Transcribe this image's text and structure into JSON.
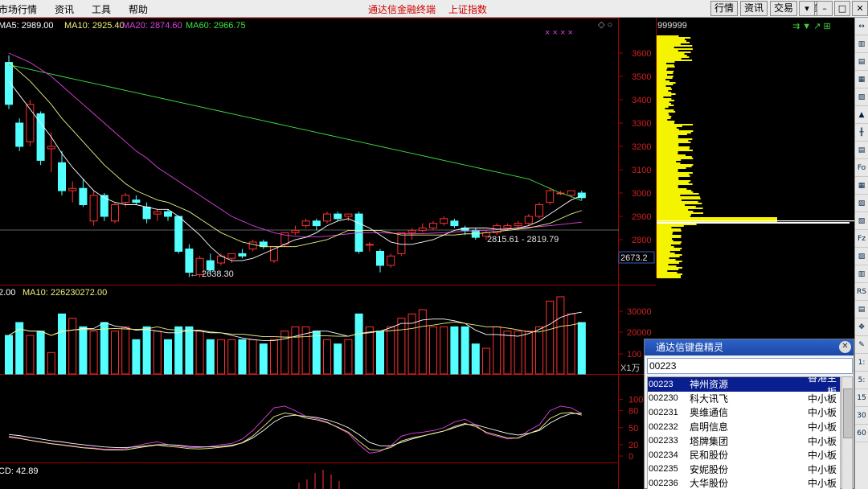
{
  "menu": [
    "市场行情",
    "资讯",
    "工具",
    "帮助"
  ],
  "app_title": [
    "通达信金融终端",
    "上证指数"
  ],
  "nav_buttons": [
    "行情",
    "资讯",
    "交易",
    "服务"
  ],
  "window_controls": [
    "▾",
    "–",
    "□",
    "✕"
  ],
  "ma_legend": [
    {
      "text": "MA5: 2989.00",
      "color": "#ffffff"
    },
    {
      "text": "MA10: 2925.40",
      "color": "#f0f080"
    },
    {
      "text": "MA20: 2874.60",
      "color": "#e040e0"
    },
    {
      "text": "MA60: 2966.75",
      "color": "#40e040"
    }
  ],
  "price_axis": [
    "3600",
    "3500",
    "3400",
    "3300",
    "3200",
    "3100",
    "3000",
    "2900",
    "2800"
  ],
  "current_price": "2673.2",
  "low_annotation": "2638.30",
  "range_annotation": "2815.61 - 2819.79",
  "volume_legend": [
    {
      "text": "2.00",
      "color": "#ffffff"
    },
    {
      "text": "MA10: 226230272.00",
      "color": "#f0f080"
    }
  ],
  "volume_axis": [
    "30000",
    "20000",
    "100"
  ],
  "volume_unit": "X1万",
  "indicator_axis": [
    "100",
    "80",
    "50",
    "20",
    "0"
  ],
  "macd_legend": "CD: 42.89",
  "profile_code": "999999",
  "right_tools": [
    "↔",
    "▥",
    "▤",
    "▦",
    "▨",
    "▲",
    "╫",
    "▤",
    "Fo",
    "▦",
    "▨",
    "▧",
    "Fz",
    "▨",
    "▥",
    "RS",
    "▤",
    "✥",
    "✎",
    "1:",
    "5:",
    "15",
    "30",
    "60"
  ],
  "keyboard_spirit": {
    "title": "通达信键盘精灵",
    "input_value": "00223",
    "rows": [
      {
        "code": "00223",
        "name": "神州资源",
        "market": "香港主板"
      },
      {
        "code": "002230",
        "name": "科大讯飞",
        "market": "中小板"
      },
      {
        "code": "002231",
        "name": "奥维通信",
        "market": "中小板"
      },
      {
        "code": "002232",
        "name": "启明信息",
        "market": "中小板"
      },
      {
        "code": "002233",
        "name": "塔牌集团",
        "market": "中小板"
      },
      {
        "code": "002234",
        "name": "民和股份",
        "market": "中小板"
      },
      {
        "code": "002235",
        "name": "安妮股份",
        "market": "中小板"
      },
      {
        "code": "002236",
        "name": "大华股份",
        "market": "中小板"
      }
    ]
  },
  "chart_data": {
    "type": "candlestick",
    "price_range": [
      2620,
      3680
    ],
    "candles": [
      {
        "o": 3560,
        "h": 3590,
        "l": 3360,
        "c": 3380
      },
      {
        "o": 3300,
        "h": 3320,
        "l": 3180,
        "c": 3200
      },
      {
        "o": 3220,
        "h": 3400,
        "l": 3200,
        "c": 3380
      },
      {
        "o": 3340,
        "h": 3350,
        "l": 3120,
        "c": 3140
      },
      {
        "o": 3190,
        "h": 3260,
        "l": 3090,
        "c": 3200
      },
      {
        "o": 3130,
        "h": 3180,
        "l": 2990,
        "c": 3010
      },
      {
        "o": 3010,
        "h": 3050,
        "l": 2960,
        "c": 3020
      },
      {
        "o": 3020,
        "h": 3060,
        "l": 2940,
        "c": 2950
      },
      {
        "o": 2880,
        "h": 3010,
        "l": 2860,
        "c": 2990
      },
      {
        "o": 2990,
        "h": 3000,
        "l": 2880,
        "c": 2900
      },
      {
        "o": 2880,
        "h": 2960,
        "l": 2870,
        "c": 2950
      },
      {
        "o": 2960,
        "h": 3000,
        "l": 2940,
        "c": 2990
      },
      {
        "o": 2970,
        "h": 2990,
        "l": 2950,
        "c": 2960
      },
      {
        "o": 2940,
        "h": 2960,
        "l": 2870,
        "c": 2890
      },
      {
        "o": 2910,
        "h": 2930,
        "l": 2880,
        "c": 2920
      },
      {
        "o": 2920,
        "h": 2930,
        "l": 2880,
        "c": 2900
      },
      {
        "o": 2900,
        "h": 2900,
        "l": 2740,
        "c": 2750
      },
      {
        "o": 2760,
        "h": 2780,
        "l": 2640,
        "c": 2660
      },
      {
        "o": 2650,
        "h": 2730,
        "l": 2638,
        "c": 2720
      },
      {
        "o": 2710,
        "h": 2740,
        "l": 2650,
        "c": 2670
      },
      {
        "o": 2700,
        "h": 2740,
        "l": 2690,
        "c": 2730
      },
      {
        "o": 2720,
        "h": 2740,
        "l": 2700,
        "c": 2740
      },
      {
        "o": 2740,
        "h": 2760,
        "l": 2720,
        "c": 2730
      },
      {
        "o": 2760,
        "h": 2800,
        "l": 2750,
        "c": 2790
      },
      {
        "o": 2790,
        "h": 2800,
        "l": 2760,
        "c": 2770
      },
      {
        "o": 2710,
        "h": 2770,
        "l": 2700,
        "c": 2770
      },
      {
        "o": 2780,
        "h": 2830,
        "l": 2770,
        "c": 2830
      },
      {
        "o": 2830,
        "h": 2860,
        "l": 2820,
        "c": 2840
      },
      {
        "o": 2860,
        "h": 2890,
        "l": 2850,
        "c": 2880
      },
      {
        "o": 2880,
        "h": 2890,
        "l": 2840,
        "c": 2860
      },
      {
        "o": 2880,
        "h": 2920,
        "l": 2870,
        "c": 2910
      },
      {
        "o": 2910,
        "h": 2920,
        "l": 2880,
        "c": 2890
      },
      {
        "o": 2900,
        "h": 2910,
        "l": 2880,
        "c": 2910
      },
      {
        "o": 2910,
        "h": 2920,
        "l": 2740,
        "c": 2750
      },
      {
        "o": 2780,
        "h": 2790,
        "l": 2750,
        "c": 2780
      },
      {
        "o": 2750,
        "h": 2760,
        "l": 2660,
        "c": 2690
      },
      {
        "o": 2690,
        "h": 2740,
        "l": 2680,
        "c": 2730
      },
      {
        "o": 2740,
        "h": 2830,
        "l": 2730,
        "c": 2830
      },
      {
        "o": 2830,
        "h": 2850,
        "l": 2800,
        "c": 2840
      },
      {
        "o": 2840,
        "h": 2870,
        "l": 2830,
        "c": 2850
      },
      {
        "o": 2850,
        "h": 2880,
        "l": 2840,
        "c": 2870
      },
      {
        "o": 2870,
        "h": 2900,
        "l": 2860,
        "c": 2890
      },
      {
        "o": 2880,
        "h": 2890,
        "l": 2850,
        "c": 2860
      },
      {
        "o": 2850,
        "h": 2860,
        "l": 2820,
        "c": 2840
      },
      {
        "o": 2840,
        "h": 2850,
        "l": 2800,
        "c": 2810
      },
      {
        "o": 2815,
        "h": 2840,
        "l": 2800,
        "c": 2830
      },
      {
        "o": 2830,
        "h": 2870,
        "l": 2820,
        "c": 2860
      },
      {
        "o": 2850,
        "h": 2870,
        "l": 2840,
        "c": 2860
      },
      {
        "o": 2860,
        "h": 2880,
        "l": 2840,
        "c": 2870
      },
      {
        "o": 2870,
        "h": 2910,
        "l": 2860,
        "c": 2900
      },
      {
        "o": 2900,
        "h": 2960,
        "l": 2890,
        "c": 2950
      },
      {
        "o": 2960,
        "h": 3020,
        "l": 2950,
        "c": 3010
      },
      {
        "o": 3000,
        "h": 3010,
        "l": 2990,
        "c": 3000
      },
      {
        "o": 2990,
        "h": 3010,
        "l": 2980,
        "c": 3010
      },
      {
        "o": 3000,
        "h": 3010,
        "l": 2970,
        "c": 2980
      }
    ],
    "ma5": [
      3480,
      3420,
      3360,
      3300,
      3240,
      3170,
      3110,
      3060,
      3010,
      2980,
      2960,
      2950,
      2950,
      2940,
      2930,
      2930,
      2900,
      2860,
      2820,
      2770,
      2730,
      2710,
      2710,
      2720,
      2740,
      2760,
      2780,
      2800,
      2810,
      2830,
      2860,
      2880,
      2890,
      2870,
      2850,
      2820,
      2790,
      2780,
      2780,
      2790,
      2800,
      2820,
      2840,
      2850,
      2850,
      2850,
      2845,
      2845,
      2850,
      2860,
      2880,
      2910,
      2940,
      2970,
      2989
    ],
    "ma10": [
      3560,
      3520,
      3480,
      3430,
      3380,
      3320,
      3270,
      3220,
      3170,
      3120,
      3080,
      3040,
      3010,
      2990,
      2970,
      2960,
      2940,
      2920,
      2890,
      2860,
      2830,
      2810,
      2790,
      2780,
      2770,
      2770,
      2770,
      2770,
      2780,
      2790,
      2800,
      2820,
      2840,
      2840,
      2840,
      2840,
      2830,
      2820,
      2820,
      2820,
      2820,
      2820,
      2820,
      2825,
      2825,
      2830,
      2835,
      2840,
      2845,
      2850,
      2860,
      2870,
      2890,
      2910,
      2925
    ],
    "ma20": [
      3600,
      3580,
      3560,
      3530,
      3500,
      3460,
      3420,
      3380,
      3340,
      3300,
      3260,
      3220,
      3180,
      3150,
      3110,
      3080,
      3050,
      3020,
      2990,
      2960,
      2930,
      2900,
      2880,
      2860,
      2845,
      2830,
      2820,
      2815,
      2812,
      2812,
      2815,
      2820,
      2825,
      2830,
      2830,
      2830,
      2828,
      2826,
      2825,
      2826,
      2828,
      2830,
      2833,
      2836,
      2838,
      2840,
      2843,
      2846,
      2850,
      2853,
      2856,
      2860,
      2865,
      2870,
      2875
    ],
    "ma60": [
      3550,
      3540,
      3530,
      3520,
      3510,
      3500,
      3490,
      3480,
      3470,
      3460,
      3450,
      3440,
      3430,
      3420,
      3410,
      3400,
      3390,
      3380,
      3370,
      3360,
      3350,
      3340,
      3330,
      3320,
      3310,
      3300,
      3290,
      3280,
      3270,
      3260,
      3250,
      3240,
      3230,
      3220,
      3210,
      3200,
      3190,
      3180,
      3170,
      3160,
      3150,
      3140,
      3130,
      3120,
      3110,
      3100,
      3090,
      3080,
      3070,
      3060,
      3040,
      3020,
      3000,
      2985,
      2967
    ],
    "volume_range": [
      0,
      38000
    ],
    "volumes": [
      18000,
      24000,
      18000,
      20000,
      10000,
      28000,
      26000,
      22000,
      20000,
      24000,
      20000,
      22000,
      16000,
      22000,
      20000,
      16000,
      22000,
      22000,
      20000,
      16000,
      16000,
      16000,
      16000,
      16000,
      14000,
      16000,
      20000,
      22000,
      22000,
      20000,
      16000,
      14000,
      16000,
      28000,
      22000,
      20000,
      22000,
      26000,
      28000,
      30000,
      22000,
      22000,
      22000,
      22000,
      14000,
      12000,
      22000,
      20000,
      20000,
      20000,
      22000,
      34000,
      36000,
      28000,
      24000
    ],
    "kdj_range": [
      0,
      120
    ],
    "kdj_k": [
      35,
      32,
      28,
      25,
      22,
      20,
      18,
      15,
      14,
      12,
      12,
      13,
      18,
      22,
      25,
      20,
      18,
      15,
      15,
      17,
      20,
      22,
      30,
      45,
      65,
      85,
      88,
      80,
      70,
      66,
      60,
      50,
      40,
      20,
      5,
      8,
      18,
      35,
      40,
      42,
      45,
      50,
      60,
      65,
      55,
      40,
      35,
      30,
      32,
      45,
      55,
      80,
      88,
      85,
      75
    ],
    "kdj_d": [
      38,
      36,
      33,
      30,
      27,
      25,
      22,
      20,
      18,
      16,
      15,
      15,
      16,
      18,
      20,
      20,
      19,
      17,
      16,
      16,
      17,
      19,
      23,
      32,
      45,
      60,
      70,
      72,
      70,
      68,
      64,
      58,
      50,
      38,
      24,
      18,
      18,
      24,
      30,
      35,
      40,
      44,
      50,
      56,
      55,
      50,
      45,
      40,
      37,
      40,
      45,
      58,
      68,
      75,
      75
    ],
    "macd_bars": [
      8,
      12,
      20,
      24,
      18,
      10
    ]
  }
}
